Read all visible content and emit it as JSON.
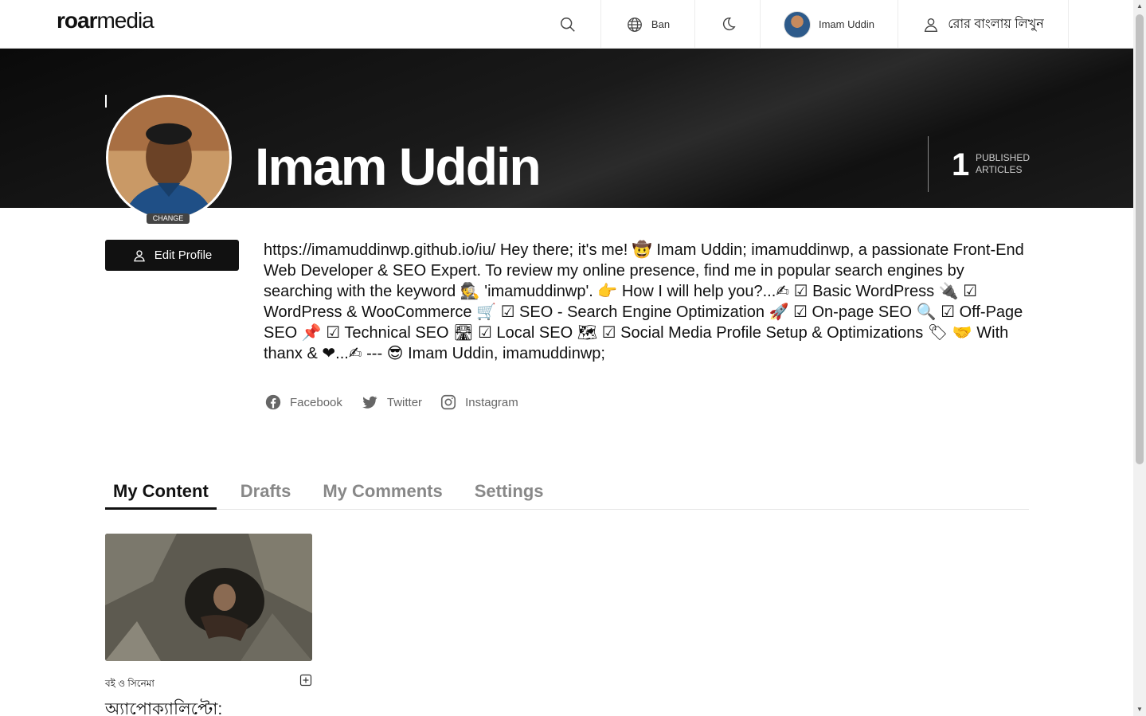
{
  "nav": {
    "logo_bold": "roar",
    "logo_light": "media",
    "lang_label": "Ban",
    "user_name": "Imam Uddin",
    "write_label": "রোর বাংলায় লিখুন"
  },
  "profile": {
    "name": "Imam Uddin",
    "published_count": "1",
    "published_label_1": "PUBLISHED",
    "published_label_2": "ARTICLES",
    "change_label": "CHANGE",
    "edit_label": "Edit Profile",
    "bio": "https://imamuddinwp.github.io/iu/ Hey there; it's me! 🤠 Imam Uddin; imamuddinwp, a passionate Front-End Web Developer & SEO Expert. To review my online presence, find me in popular search engines by searching with the keyword 🕵 'imamuddinwp'. 👉 How I will help you?...✍ ☑ Basic WordPress 🔌 ☑ WordPress & WooCommerce 🛒 ☑ SEO - Search Engine Optimization 🚀 ☑ On-page SEO 🔍 ☑ Off-Page SEO 📌 ☑ Technical SEO 🛣 ☑ Local SEO 🗺 ☑ Social Media Profile Setup & Optimizations 🏷 🤝 With thanx & ❤...✍ --- 😎 Imam Uddin, imamuddinwp;"
  },
  "socials": [
    {
      "label": "Facebook",
      "icon": "facebook-icon"
    },
    {
      "label": "Twitter",
      "icon": "twitter-icon"
    },
    {
      "label": "Instagram",
      "icon": "instagram-icon"
    }
  ],
  "tabs": [
    {
      "label": "My Content",
      "active": true
    },
    {
      "label": "Drafts",
      "active": false
    },
    {
      "label": "My Comments",
      "active": false
    },
    {
      "label": "Settings",
      "active": false
    }
  ],
  "article": {
    "category": "বই ও সিনেমা",
    "title": "অ্যাপোক্যালিপ্টো:"
  }
}
